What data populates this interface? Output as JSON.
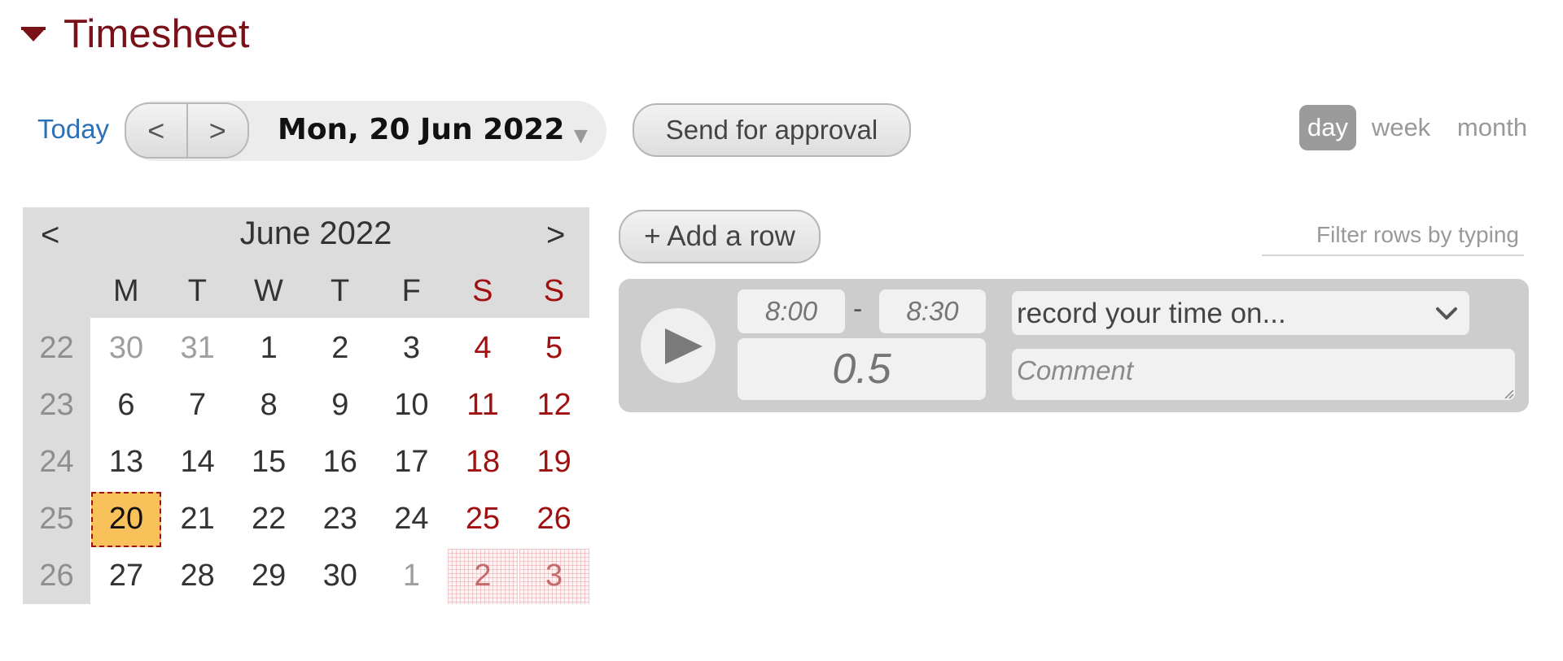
{
  "section": {
    "title": "Timesheet",
    "collapse_icon": "caret-down-icon"
  },
  "toolbar": {
    "today_label": "Today",
    "prev_label": "<",
    "next_label": ">",
    "current_date": "Mon, 20 Jun 2022",
    "date_dropdown_icon": "caret-down-icon",
    "send_label": "Send for approval",
    "views": [
      {
        "label": "day",
        "active": true
      },
      {
        "label": "week",
        "active": false
      },
      {
        "label": "month",
        "active": false
      }
    ]
  },
  "calendar": {
    "month_label": "June 2022",
    "prev_label": "<",
    "next_label": ">",
    "weekdays": [
      "M",
      "T",
      "W",
      "T",
      "F",
      "S",
      "S"
    ],
    "weeks": [
      {
        "number": "22",
        "days": [
          "30",
          "31",
          "1",
          "2",
          "3",
          "4",
          "5"
        ]
      },
      {
        "number": "23",
        "days": [
          "6",
          "7",
          "8",
          "9",
          "10",
          "11",
          "12"
        ]
      },
      {
        "number": "24",
        "days": [
          "13",
          "14",
          "15",
          "16",
          "17",
          "18",
          "19"
        ]
      },
      {
        "number": "25",
        "days": [
          "20",
          "21",
          "22",
          "23",
          "24",
          "25",
          "26"
        ]
      },
      {
        "number": "26",
        "days": [
          "27",
          "28",
          "29",
          "30",
          "1",
          "2",
          "3"
        ]
      }
    ],
    "selected_day": "20",
    "colors": {
      "weekend": "#a01010",
      "selected_bg": "#f9c15a",
      "header_bg": "#dcdcdc"
    }
  },
  "entries": {
    "add_row_label": "+ Add a row",
    "filter_placeholder": "Filter rows by typing",
    "row": {
      "play_icon": "play-icon",
      "start_placeholder": "8:00",
      "separator": "-",
      "end_placeholder": "8:30",
      "duration_placeholder": "0.5",
      "project_placeholder": "record your time on...",
      "project_dropdown_icon": "chevron-down-icon",
      "comment_placeholder": "Comment"
    }
  },
  "colors": {
    "title": "#7a1018",
    "link": "#2d70b7",
    "active_view_bg": "#9b9b9b",
    "row_bg": "#cdcdcd"
  }
}
